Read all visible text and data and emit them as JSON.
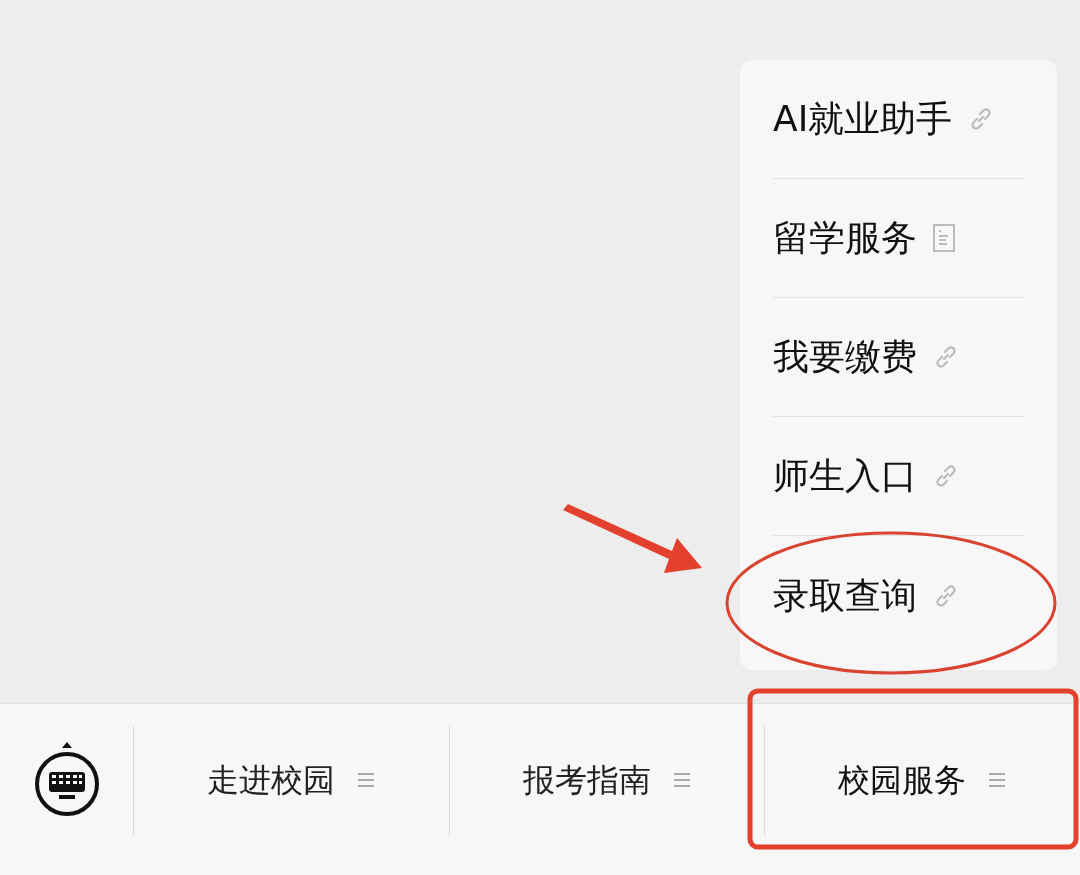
{
  "menu_popup": {
    "items": [
      {
        "label": "AI就业助手",
        "kind": "link"
      },
      {
        "label": "留学服务",
        "kind": "article"
      },
      {
        "label": "我要缴费",
        "kind": "link"
      },
      {
        "label": "师生入口",
        "kind": "link"
      },
      {
        "label": "录取查询",
        "kind": "link"
      }
    ]
  },
  "bottom_menu": {
    "tabs": [
      {
        "label": "走进校园",
        "selected": false
      },
      {
        "label": "报考指南",
        "selected": false
      },
      {
        "label": "校园服务",
        "selected": true
      }
    ]
  },
  "annotations": [
    {
      "kind": "arrow"
    },
    {
      "kind": "ellipse"
    },
    {
      "kind": "rectangle"
    }
  ]
}
